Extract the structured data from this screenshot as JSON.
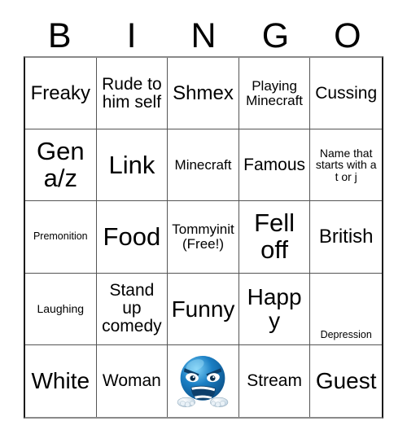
{
  "card": {
    "header_letters": [
      "B",
      "I",
      "N",
      "G",
      "O"
    ],
    "columns": 5,
    "rows": 5,
    "background_color": "#ffffff",
    "text_color": "#000000",
    "border_color": "#555555",
    "outer_border_color": "#1a1a1a",
    "free_space_position": "center",
    "cells": [
      [
        {
          "label": "Freaky",
          "size": "lg",
          "type": "text"
        },
        {
          "label": "Rude to him self",
          "size": "md",
          "type": "text"
        },
        {
          "label": "Shmex",
          "size": "lg",
          "type": "text"
        },
        {
          "label": "Playing Minecraft",
          "size": "sm",
          "type": "text"
        },
        {
          "label": "Cussing",
          "size": "md",
          "type": "text"
        }
      ],
      [
        {
          "label": "Gen a/z",
          "size": "xxl",
          "type": "text"
        },
        {
          "label": "Link",
          "size": "xxl",
          "type": "text"
        },
        {
          "label": "Minecraft",
          "size": "sm",
          "type": "text"
        },
        {
          "label": "Famous",
          "size": "md",
          "type": "text"
        },
        {
          "label": "Name that starts with a t or j",
          "size": "xs",
          "type": "text"
        }
      ],
      [
        {
          "label": "Premonition",
          "size": "xxs",
          "type": "text"
        },
        {
          "label": "Food",
          "size": "xxl",
          "type": "text"
        },
        {
          "label": "Tommyinit (Free!)",
          "size": "sm",
          "type": "text",
          "free": true
        },
        {
          "label": "Fell off",
          "size": "xxl",
          "type": "text"
        },
        {
          "label": "British",
          "size": "lg",
          "type": "text"
        }
      ],
      [
        {
          "label": "Laughing",
          "size": "xs",
          "type": "text"
        },
        {
          "label": "Stand up comedy",
          "size": "md",
          "type": "text"
        },
        {
          "label": "Funny",
          "size": "xl",
          "type": "text"
        },
        {
          "label": "Happy",
          "size": "xl",
          "type": "text"
        },
        {
          "label": "Depression",
          "size": "xxs",
          "type": "text",
          "align": "bottom"
        }
      ],
      [
        {
          "label": "White",
          "size": "xl",
          "type": "text"
        },
        {
          "label": "Woman",
          "size": "md",
          "type": "text"
        },
        {
          "label": "",
          "size": "md",
          "type": "image",
          "image_name": "blue-screaming-angry-face-emoji"
        },
        {
          "label": "Stream",
          "size": "md",
          "type": "text"
        },
        {
          "label": "Guest",
          "size": "xl",
          "type": "text"
        }
      ]
    ]
  },
  "emoji": {
    "name": "blue-screaming-angry-face-emoji",
    "face_color_light": "#4db8f0",
    "face_color_mid": "#1b7fc4",
    "face_color_dark": "#0b4f86",
    "mouth_color": "#0d3f6b",
    "tooth_color": "#ffffff",
    "fist_color": "#b9cfe0"
  }
}
